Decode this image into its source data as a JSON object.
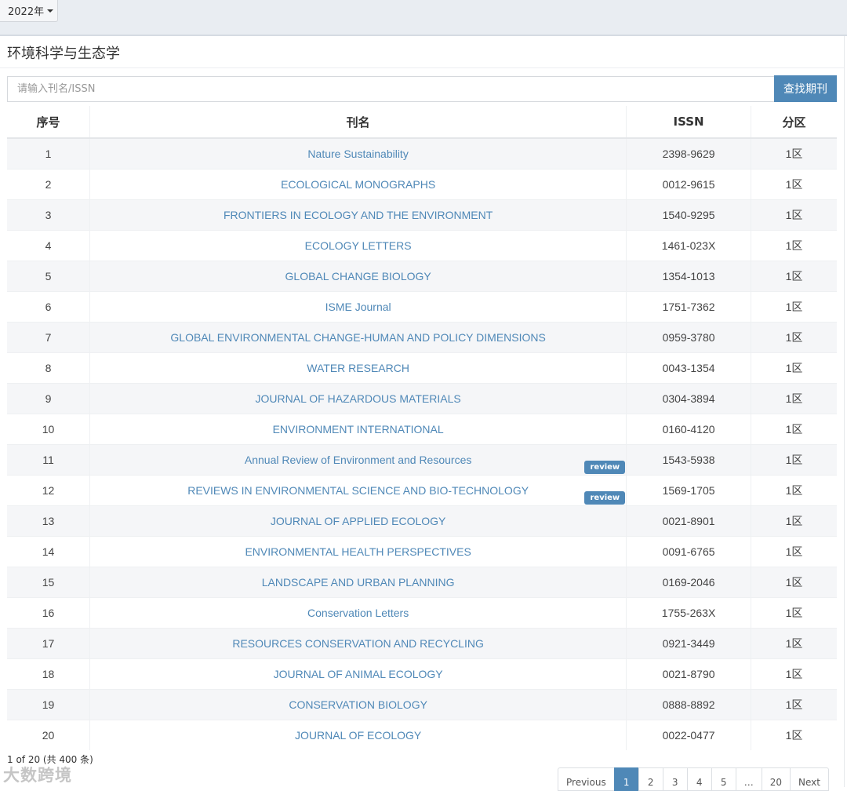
{
  "year_selector": {
    "label": "2022年"
  },
  "section": {
    "title": "环境科学与生态学"
  },
  "search": {
    "placeholder": "请输入刊名/ISSN",
    "button_label": "查找期刊"
  },
  "table": {
    "headers": {
      "index": "序号",
      "name": "刊名",
      "issn": "ISSN",
      "zone": "分区"
    },
    "rows": [
      {
        "index": "1",
        "name": "Nature Sustainability",
        "issn": "2398-9629",
        "zone": "1区",
        "badge": ""
      },
      {
        "index": "2",
        "name": "ECOLOGICAL MONOGRAPHS",
        "issn": "0012-9615",
        "zone": "1区",
        "badge": ""
      },
      {
        "index": "3",
        "name": "FRONTIERS IN ECOLOGY AND THE ENVIRONMENT",
        "issn": "1540-9295",
        "zone": "1区",
        "badge": ""
      },
      {
        "index": "4",
        "name": "ECOLOGY LETTERS",
        "issn": "1461-023X",
        "zone": "1区",
        "badge": ""
      },
      {
        "index": "5",
        "name": "GLOBAL CHANGE BIOLOGY",
        "issn": "1354-1013",
        "zone": "1区",
        "badge": ""
      },
      {
        "index": "6",
        "name": "ISME Journal",
        "issn": "1751-7362",
        "zone": "1区",
        "badge": ""
      },
      {
        "index": "7",
        "name": "GLOBAL ENVIRONMENTAL CHANGE-HUMAN AND POLICY DIMENSIONS",
        "issn": "0959-3780",
        "zone": "1区",
        "badge": ""
      },
      {
        "index": "8",
        "name": "WATER RESEARCH",
        "issn": "0043-1354",
        "zone": "1区",
        "badge": ""
      },
      {
        "index": "9",
        "name": "JOURNAL OF HAZARDOUS MATERIALS",
        "issn": "0304-3894",
        "zone": "1区",
        "badge": ""
      },
      {
        "index": "10",
        "name": "ENVIRONMENT INTERNATIONAL",
        "issn": "0160-4120",
        "zone": "1区",
        "badge": ""
      },
      {
        "index": "11",
        "name": "Annual Review of Environment and Resources",
        "issn": "1543-5938",
        "zone": "1区",
        "badge": "review"
      },
      {
        "index": "12",
        "name": "REVIEWS IN ENVIRONMENTAL SCIENCE AND BIO-TECHNOLOGY",
        "issn": "1569-1705",
        "zone": "1区",
        "badge": "review"
      },
      {
        "index": "13",
        "name": "JOURNAL OF APPLIED ECOLOGY",
        "issn": "0021-8901",
        "zone": "1区",
        "badge": ""
      },
      {
        "index": "14",
        "name": "ENVIRONMENTAL HEALTH PERSPECTIVES",
        "issn": "0091-6765",
        "zone": "1区",
        "badge": ""
      },
      {
        "index": "15",
        "name": "LANDSCAPE AND URBAN PLANNING",
        "issn": "0169-2046",
        "zone": "1区",
        "badge": ""
      },
      {
        "index": "16",
        "name": "Conservation Letters",
        "issn": "1755-263X",
        "zone": "1区",
        "badge": ""
      },
      {
        "index": "17",
        "name": "RESOURCES CONSERVATION AND RECYCLING",
        "issn": "0921-3449",
        "zone": "1区",
        "badge": ""
      },
      {
        "index": "18",
        "name": "JOURNAL OF ANIMAL ECOLOGY",
        "issn": "0021-8790",
        "zone": "1区",
        "badge": ""
      },
      {
        "index": "19",
        "name": "CONSERVATION BIOLOGY",
        "issn": "0888-8892",
        "zone": "1区",
        "badge": ""
      },
      {
        "index": "20",
        "name": "JOURNAL OF ECOLOGY",
        "issn": "0022-0477",
        "zone": "1区",
        "badge": ""
      }
    ]
  },
  "footer": {
    "info": "1 of 20 (共 400 条)",
    "watermark": "大数跨境"
  },
  "pagination": {
    "previous": "Previous",
    "pages": [
      "1",
      "2",
      "3",
      "4",
      "5",
      "…",
      "20"
    ],
    "active": "1",
    "next": "Next"
  },
  "colors": {
    "accent": "#4f88b7",
    "stripe": "#f5f6f8"
  }
}
